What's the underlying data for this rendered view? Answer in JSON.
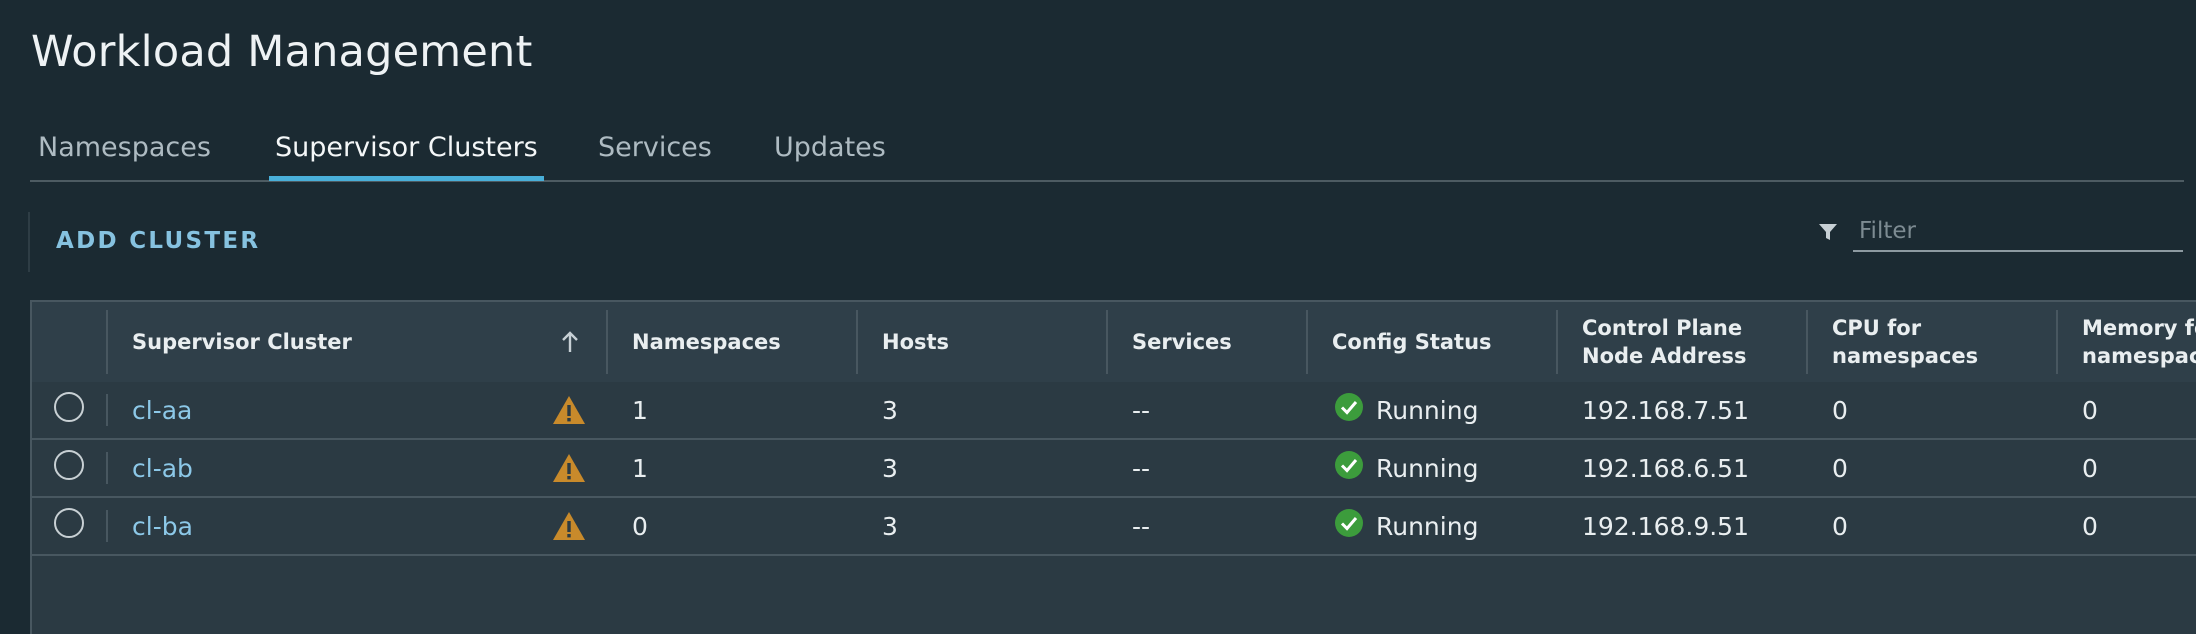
{
  "page": {
    "title": "Workload Management"
  },
  "tabs": [
    {
      "label": "Namespaces",
      "active": false
    },
    {
      "label": "Supervisor Clusters",
      "active": true
    },
    {
      "label": "Services",
      "active": false
    },
    {
      "label": "Updates",
      "active": false
    }
  ],
  "toolbar": {
    "add_cluster_label": "ADD CLUSTER",
    "filter_placeholder": "Filter",
    "filter_icon": "filter-icon"
  },
  "table": {
    "columns": [
      {
        "label": "Supervisor Cluster",
        "sort": "ascending"
      },
      {
        "label": "Namespaces"
      },
      {
        "label": "Hosts"
      },
      {
        "label": "Services"
      },
      {
        "label": "Config Status"
      },
      {
        "label_line1": "Control Plane",
        "label_line2": "Node Address"
      },
      {
        "label_line1": "CPU for",
        "label_line2": "namespaces"
      },
      {
        "label_line1": "Memory for",
        "label_line2": "namespaces"
      }
    ],
    "rows": [
      {
        "cluster": "cl-aa",
        "warning": true,
        "namespaces": "1",
        "hosts": "3",
        "services": "--",
        "config_status": "Running",
        "address": "192.168.7.51",
        "cpu": "0",
        "memory": "0"
      },
      {
        "cluster": "cl-ab",
        "warning": true,
        "namespaces": "1",
        "hosts": "3",
        "services": "--",
        "config_status": "Running",
        "address": "192.168.6.51",
        "cpu": "0",
        "memory": "0"
      },
      {
        "cluster": "cl-ba",
        "warning": true,
        "namespaces": "0",
        "hosts": "3",
        "services": "--",
        "config_status": "Running",
        "address": "192.168.9.51",
        "cpu": "0",
        "memory": "0"
      }
    ]
  },
  "colors": {
    "background": "#1b2a32",
    "accent": "#49afd9",
    "link": "#8cc8e8",
    "warning": "#c88a2b",
    "success": "#3c9c3c"
  }
}
